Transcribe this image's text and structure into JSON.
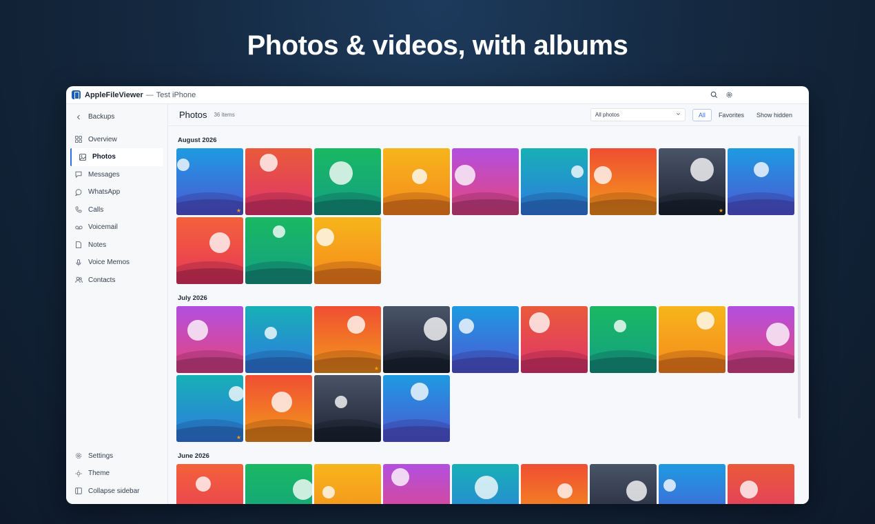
{
  "headline": "Photos & videos, with albums",
  "window": {
    "app_name": "AppleFileViewer",
    "separator": "—",
    "device": "Test iPhone"
  },
  "sidebar": {
    "back_label": "Backups",
    "items": [
      {
        "label": "Overview",
        "icon": "grid-icon"
      },
      {
        "label": "Photos",
        "icon": "image-icon",
        "active": true
      },
      {
        "label": "Messages",
        "icon": "message-icon"
      },
      {
        "label": "WhatsApp",
        "icon": "chat-bubble-icon"
      },
      {
        "label": "Calls",
        "icon": "phone-icon"
      },
      {
        "label": "Voicemail",
        "icon": "voicemail-icon"
      },
      {
        "label": "Notes",
        "icon": "note-icon"
      },
      {
        "label": "Voice Memos",
        "icon": "microphone-icon"
      },
      {
        "label": "Contacts",
        "icon": "people-icon"
      }
    ],
    "bottom": [
      {
        "label": "Settings",
        "icon": "gear-icon"
      },
      {
        "label": "Theme",
        "icon": "sun-icon"
      },
      {
        "label": "Collapse sidebar",
        "icon": "sidebar-icon"
      }
    ]
  },
  "toolbar": {
    "title": "Photos",
    "count": "36 items",
    "filter_value": "All photos",
    "segments": [
      "All",
      "Favorites",
      "Show hidden"
    ],
    "active_segment": "All"
  },
  "sections": [
    {
      "title": "August 2026",
      "photos": [
        {
          "palette": "blue",
          "sun": [
            0.1,
            0.25
          ],
          "star": true
        },
        {
          "palette": "red",
          "sun": [
            0.35,
            0.22
          ]
        },
        {
          "palette": "green",
          "sun": [
            0.4,
            0.37
          ]
        },
        {
          "palette": "yellow",
          "sun": [
            0.55,
            0.42
          ]
        },
        {
          "palette": "purple",
          "sun": [
            0.2,
            0.4
          ]
        },
        {
          "palette": "teal",
          "sun": [
            0.85,
            0.35
          ]
        },
        {
          "palette": "orange",
          "sun": [
            0.2,
            0.4
          ]
        },
        {
          "palette": "slate",
          "sun": [
            0.65,
            0.32
          ],
          "star": true
        },
        {
          "palette": "blue",
          "sun": [
            0.5,
            0.32
          ]
        },
        {
          "palette": "coral",
          "sun": [
            0.65,
            0.38
          ]
        },
        {
          "palette": "green",
          "sun": [
            0.5,
            0.22
          ]
        },
        {
          "palette": "yellow",
          "sun": [
            0.17,
            0.3
          ]
        }
      ]
    },
    {
      "title": "July 2026",
      "photos": [
        {
          "palette": "purple",
          "sun": [
            0.32,
            0.36
          ]
        },
        {
          "palette": "teal",
          "sun": [
            0.38,
            0.4
          ]
        },
        {
          "palette": "orange",
          "sun": [
            0.63,
            0.28
          ],
          "star": true
        },
        {
          "palette": "slate",
          "sun": [
            0.78,
            0.34
          ]
        },
        {
          "palette": "blue",
          "sun": [
            0.22,
            0.3
          ]
        },
        {
          "palette": "red",
          "sun": [
            0.28,
            0.25
          ]
        },
        {
          "palette": "green",
          "sun": [
            0.45,
            0.3
          ]
        },
        {
          "palette": "yellow",
          "sun": [
            0.7,
            0.22
          ]
        },
        {
          "palette": "purple",
          "sun": [
            0.75,
            0.42
          ]
        },
        {
          "palette": "teal",
          "sun": [
            0.9,
            0.28
          ],
          "star": true
        },
        {
          "palette": "orange",
          "sun": [
            0.55,
            0.4
          ]
        },
        {
          "palette": "slate",
          "sun": [
            0.4,
            0.4
          ]
        },
        {
          "palette": "blue",
          "sun": [
            0.55,
            0.25
          ]
        }
      ]
    },
    {
      "title": "June 2026",
      "photos": [
        {
          "palette": "coral",
          "sun": [
            0.4,
            0.3
          ]
        },
        {
          "palette": "green",
          "sun": [
            0.87,
            0.38
          ]
        },
        {
          "palette": "yellow",
          "sun": [
            0.22,
            0.42
          ]
        },
        {
          "palette": "purple",
          "sun": [
            0.26,
            0.2
          ]
        },
        {
          "palette": "teal",
          "sun": [
            0.52,
            0.35
          ]
        },
        {
          "palette": "orange",
          "sun": [
            0.66,
            0.4
          ]
        },
        {
          "palette": "slate",
          "sun": [
            0.7,
            0.4
          ]
        },
        {
          "palette": "blue",
          "sun": [
            0.17,
            0.32
          ]
        },
        {
          "palette": "red",
          "sun": [
            0.32,
            0.38
          ]
        }
      ]
    }
  ],
  "palettes": {
    "blue": {
      "top": "#1e9be0",
      "bottom": "#4c58d6",
      "wave": "#2e2a78"
    },
    "red": {
      "top": "#ea5a3a",
      "bottom": "#e0356a",
      "wave": "#7a1a40"
    },
    "green": {
      "top": "#1ab863",
      "bottom": "#13a082",
      "wave": "#0c4a48"
    },
    "yellow": {
      "top": "#f7b51b",
      "bottom": "#f58a1d",
      "wave": "#8a3d12"
    },
    "purple": {
      "top": "#b24fe0",
      "bottom": "#e6457a",
      "wave": "#6b1f4e"
    },
    "teal": {
      "top": "#17b0b6",
      "bottom": "#2e7be0",
      "wave": "#1b3f7a"
    },
    "orange": {
      "top": "#f04e33",
      "bottom": "#f39a1a",
      "wave": "#7a3d10"
    },
    "slate": {
      "top": "#4a5468",
      "bottom": "#1d2433",
      "wave": "#0c111a"
    },
    "coral": {
      "top": "#f3623a",
      "bottom": "#e73858",
      "wave": "#701738"
    }
  }
}
